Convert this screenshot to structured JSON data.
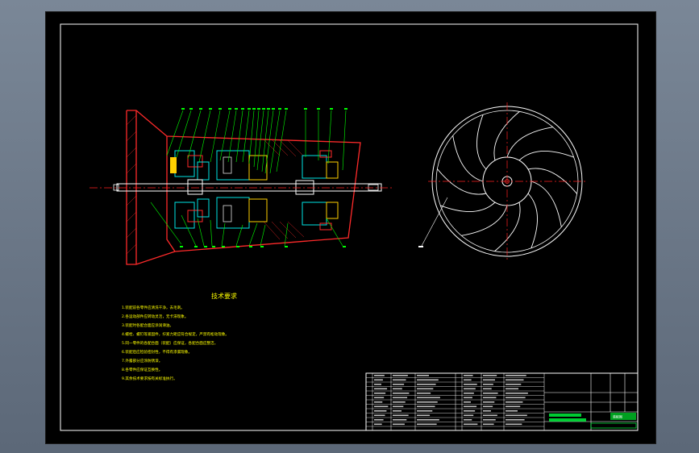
{
  "technical_requirements": {
    "title": "技术要求",
    "lines": [
      "1.装配前各零件应清洗干净，去毛刺。",
      "2.各运动部件应转动灵活，无卡滞现象。",
      "3.装配时各配合面应涂润滑油。",
      "4.螺栓、螺钉等紧固件，拧紧力矩应符合规定，严禁有松动现象。",
      "5.同一零件的各配合面（装配）应保证，各配合面应整洁。",
      "6.装配后应检验密封性，不得有渗漏现象。",
      "7.外露部分应涂防锈漆。",
      "8.各零件应保证互换性。",
      "9.其余技术要求按有关标准执行。"
    ]
  },
  "title_block": {
    "drawing_name": "装配图"
  },
  "colors": {
    "background": "#000000",
    "section_red": "#ff2020",
    "centerline_red": "#ff0000",
    "leader_green": "#00ff00",
    "hatch_cyan": "#00e5e5",
    "hatch_yellow": "#ffd000",
    "frame_white": "#ffffff",
    "text_yellow": "#ffff00",
    "titleblock_green": "#00ff40"
  }
}
